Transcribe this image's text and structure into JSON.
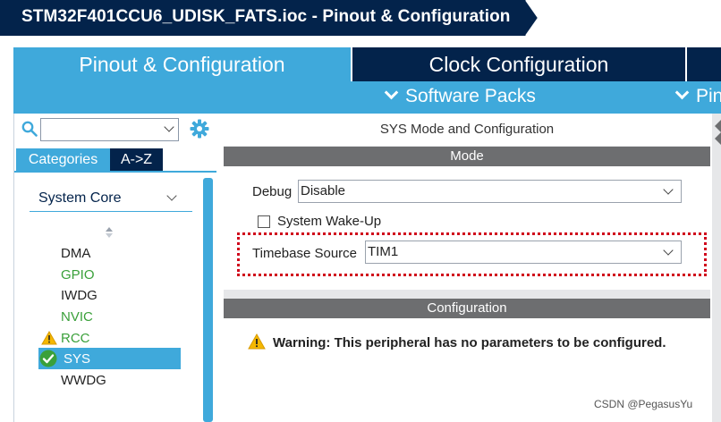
{
  "window": {
    "title": "STM32F401CCU6_UDISK_FATS.ioc - Pinout & Configuration"
  },
  "tabs": {
    "pinout_config": "Pinout & Configuration",
    "clock_config": "Clock Configuration"
  },
  "subtoolbar": {
    "software_packs": "Software Packs",
    "pinout_partial": "Pin"
  },
  "left_panel": {
    "search_value": "",
    "view_tabs": [
      "Categories",
      "A->Z"
    ],
    "group": "System Core",
    "peripherals": [
      {
        "label": "DMA",
        "status": "none",
        "color": "#222222"
      },
      {
        "label": "GPIO",
        "status": "configured",
        "color": "#3aa03a"
      },
      {
        "label": "IWDG",
        "status": "none",
        "color": "#222222"
      },
      {
        "label": "NVIC",
        "status": "configured",
        "color": "#3aa03a"
      },
      {
        "label": "RCC",
        "status": "warning-icon",
        "color": "#3aa03a"
      },
      {
        "label": "SYS",
        "status": "check-icon",
        "color": "#ffffff",
        "selected": true
      },
      {
        "label": "WWDG",
        "status": "none",
        "color": "#222222"
      }
    ]
  },
  "right_panel": {
    "title": "SYS Mode and Configuration",
    "mode_header": "Mode",
    "debug_label": "Debug",
    "debug_value": "Disable",
    "wakeup_label": "System Wake-Up",
    "wakeup_checked": false,
    "timebase_label": "Timebase Source",
    "timebase_value": "TIM1",
    "config_header": "Configuration",
    "warning_text": "Warning: This peripheral has no parameters to be configured."
  },
  "watermark": "CSDN @PegasusYu",
  "colors": {
    "navy": "#03234b",
    "accent_blue": "#3fa9db",
    "section_gray": "#6d6e70",
    "configured_green": "#3aa03a",
    "highlight_red": "#d0021b"
  }
}
